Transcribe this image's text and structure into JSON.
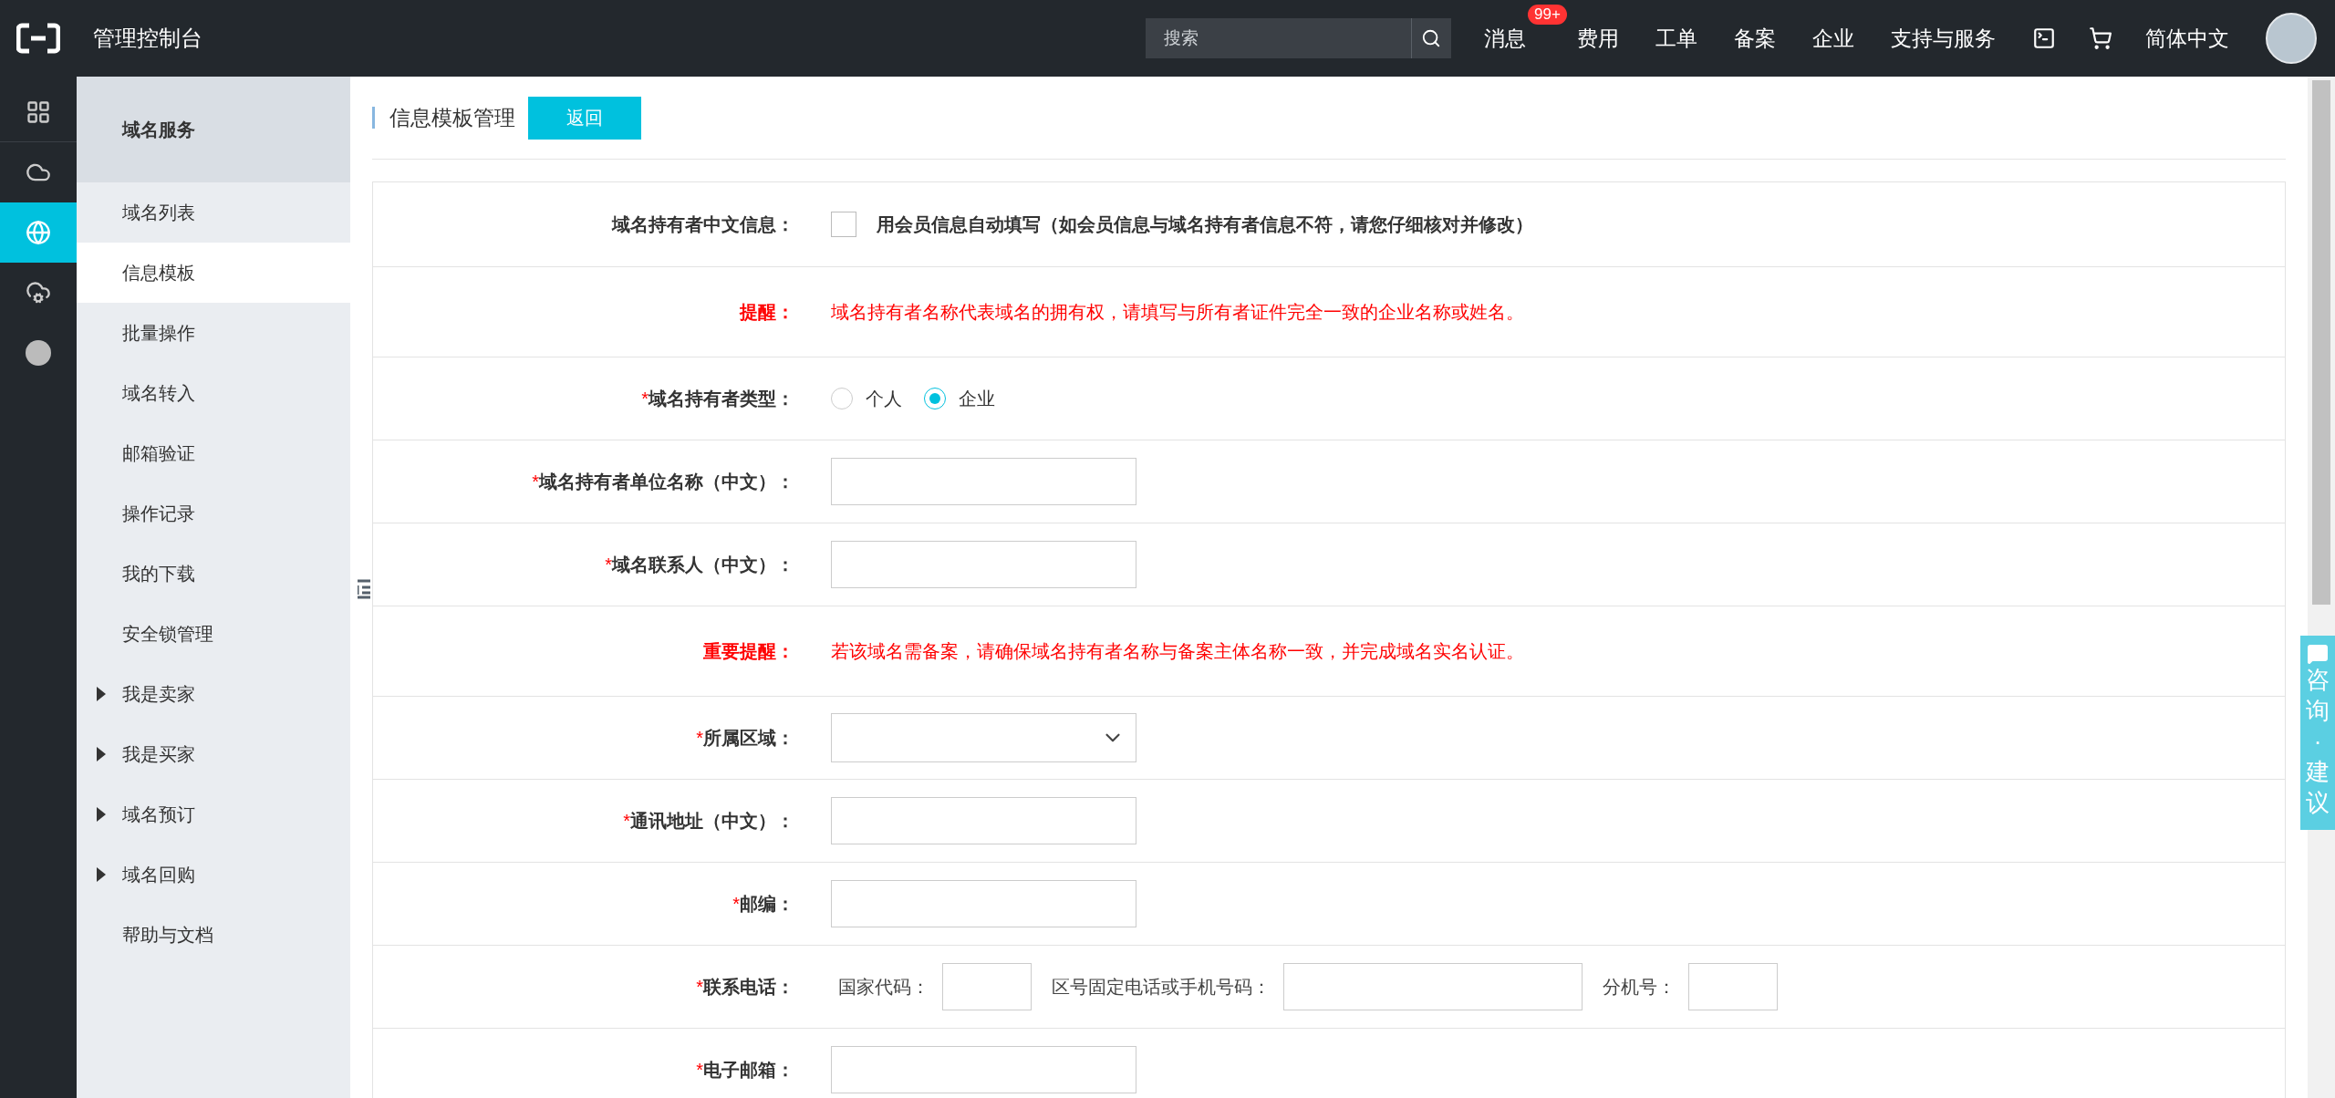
{
  "topbar": {
    "title": "管理控制台",
    "search": {
      "placeholder": "搜索"
    },
    "nav": [
      {
        "label": "消息",
        "badge": "99+"
      },
      {
        "label": "费用"
      },
      {
        "label": "工单"
      },
      {
        "label": "备案"
      },
      {
        "label": "企业"
      },
      {
        "label": "支持与服务"
      }
    ],
    "language": "简体中文"
  },
  "rail": [
    {
      "selected": false
    },
    {
      "selected": false
    },
    {
      "selected": true
    },
    {
      "selected": false
    },
    {
      "selected": false
    }
  ],
  "sidebar": {
    "title": "域名服务",
    "items": [
      {
        "label": "域名列表",
        "kind": "link",
        "selected": false
      },
      {
        "label": "信息模板",
        "kind": "link",
        "selected": true
      },
      {
        "label": "批量操作",
        "kind": "link",
        "selected": false
      },
      {
        "label": "域名转入",
        "kind": "link",
        "selected": false
      },
      {
        "label": "邮箱验证",
        "kind": "link",
        "selected": false
      },
      {
        "label": "操作记录",
        "kind": "link",
        "selected": false
      },
      {
        "label": "我的下载",
        "kind": "link",
        "selected": false
      },
      {
        "label": "安全锁管理",
        "kind": "link",
        "selected": false
      },
      {
        "label": "我是卖家",
        "kind": "group",
        "selected": false,
        "expanded": false
      },
      {
        "label": "我是买家",
        "kind": "group",
        "selected": false,
        "expanded": false
      },
      {
        "label": "域名预订",
        "kind": "group",
        "selected": false,
        "expanded": false
      },
      {
        "label": "域名回购",
        "kind": "group",
        "selected": false,
        "expanded": false
      },
      {
        "label": "帮助与文档",
        "kind": "link",
        "selected": false
      }
    ]
  },
  "page": {
    "title": "信息模板管理",
    "back_button": "返回"
  },
  "form": {
    "rows": [
      {
        "kind": "checkbox",
        "label": "域名持有者中文信息：",
        "option": "用会员信息自动填写（如会员信息与域名持有者信息不符，请您仔细核对并修改）",
        "checked": false
      },
      {
        "kind": "notice",
        "label": "提醒：",
        "text": "域名持有者名称代表域名的拥有权，请填写与所有者证件完全一致的企业名称或姓名。"
      },
      {
        "kind": "radio",
        "mark": "*",
        "label": "域名持有者类型：",
        "options": [
          {
            "label": "个人",
            "selected": false
          },
          {
            "label": "企业",
            "selected": true
          }
        ]
      },
      {
        "kind": "text",
        "mark": "*",
        "label": "域名持有者单位名称（中文）："
      },
      {
        "kind": "text",
        "mark": "*",
        "label": "域名联系人（中文）："
      },
      {
        "kind": "notice",
        "label": "重要提醒：",
        "text": "若该域名需备案，请确保域名持有者名称与备案主体名称一致，并完成域名实名认证。"
      },
      {
        "kind": "select",
        "mark": "*",
        "label": "所属区域："
      },
      {
        "kind": "text",
        "mark": "*",
        "label": "通讯地址（中文）："
      },
      {
        "kind": "text",
        "mark": "*",
        "label": "邮编："
      },
      {
        "kind": "phone",
        "mark": "*",
        "label": "联系电话：",
        "fields": [
          {
            "label": "国家代码：",
            "kind": "short"
          },
          {
            "label": "区号固定电话或手机号码：",
            "kind": "long"
          },
          {
            "label": "分机号：",
            "kind": "short"
          }
        ]
      },
      {
        "kind": "text",
        "mark": "*",
        "label": "电子邮箱："
      }
    ]
  },
  "feedback_tab": "咨询·建议"
}
